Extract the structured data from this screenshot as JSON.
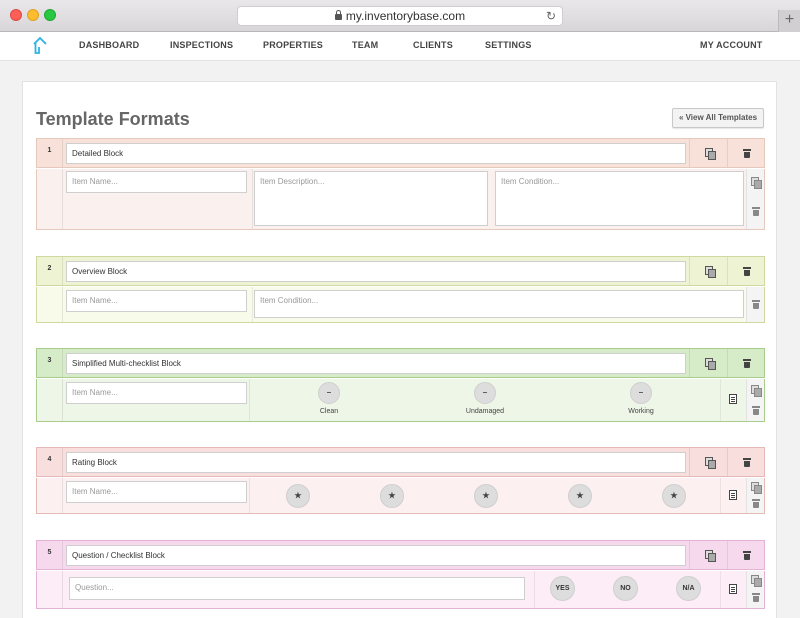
{
  "browser": {
    "url": "my.inventorybase.com",
    "newtab_symbol": "+",
    "reload_symbol": "↻"
  },
  "nav": {
    "items": [
      "DASHBOARD",
      "INSPECTIONS",
      "PROPERTIES",
      "TEAM",
      "CLIENTS",
      "SETTINGS"
    ],
    "account": "MY ACCOUNT",
    "accent": "#2bb4e3"
  },
  "page": {
    "title": "Template Formats",
    "view_all": "« View All Templates"
  },
  "blocks": [
    {
      "number": "1",
      "name": "Detailed Block",
      "head_color": "#f8e1d8",
      "body_color": "#faf1ee",
      "border_color": "#e6c9bd",
      "item_name_ph": "Item Name...",
      "desc_ph": "Item Description...",
      "cond_ph": "Item Condition..."
    },
    {
      "number": "2",
      "name": "Overview Block",
      "head_color": "#eef3d4",
      "body_color": "#f8faea",
      "border_color": "#cfd89e",
      "item_name_ph": "Item Name...",
      "cond_ph": "Item Condition..."
    },
    {
      "number": "3",
      "name": "Simplified Multi-checklist Block",
      "head_color": "#d6ebc8",
      "body_color": "#eef6e8",
      "border_color": "#a8cc8e",
      "item_name_ph": "Item Name...",
      "checks": [
        {
          "symbol": "–",
          "label": "Clean"
        },
        {
          "symbol": "–",
          "label": "Undamaged"
        },
        {
          "symbol": "–",
          "label": "Working"
        }
      ]
    },
    {
      "number": "4",
      "name": "Rating Block",
      "head_color": "#f9dede",
      "body_color": "#fdf0f0",
      "border_color": "#e6b9b9",
      "item_name_ph": "Item Name...",
      "stars": [
        "★",
        "★",
        "★",
        "★",
        "★"
      ]
    },
    {
      "number": "5",
      "name": "Question / Checklist Block",
      "head_color": "#f7d9ee",
      "body_color": "#fcedf7",
      "border_color": "#e2b3d4",
      "question_ph": "Question...",
      "answers": [
        "YES",
        "NO",
        "N/A"
      ]
    }
  ]
}
